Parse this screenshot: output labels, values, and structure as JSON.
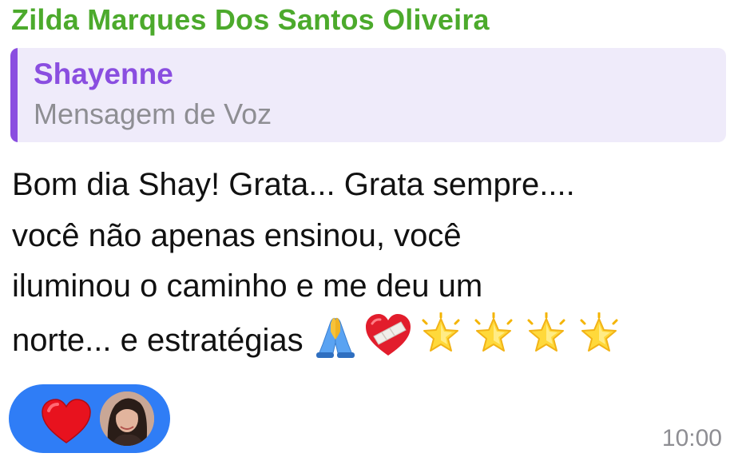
{
  "message": {
    "sender_name": "Zilda Marques Dos Santos Oliveira",
    "reply": {
      "author": "Shayenne",
      "preview": "Mensagem de Voz"
    },
    "text_lines": [
      "Bom dia Shay! Grata... Grata sempre....",
      "você não apenas ensinou, você",
      "iluminou o caminho e me deu um",
      "norte... e estratégias"
    ],
    "emojis": [
      "pray-icon",
      "mending-heart-icon",
      "star-icon",
      "star-icon",
      "star-icon",
      "star-icon"
    ],
    "time": "10:00"
  },
  "reactions": {
    "emoji": "heart-icon",
    "reactor": "avatar"
  },
  "colors": {
    "sender": "#4caa2c",
    "reply_accent": "#8a4ee0",
    "reply_background": "#efebfa",
    "reaction_pill": "#2f7df6",
    "timestamp": "#8e8e93"
  }
}
